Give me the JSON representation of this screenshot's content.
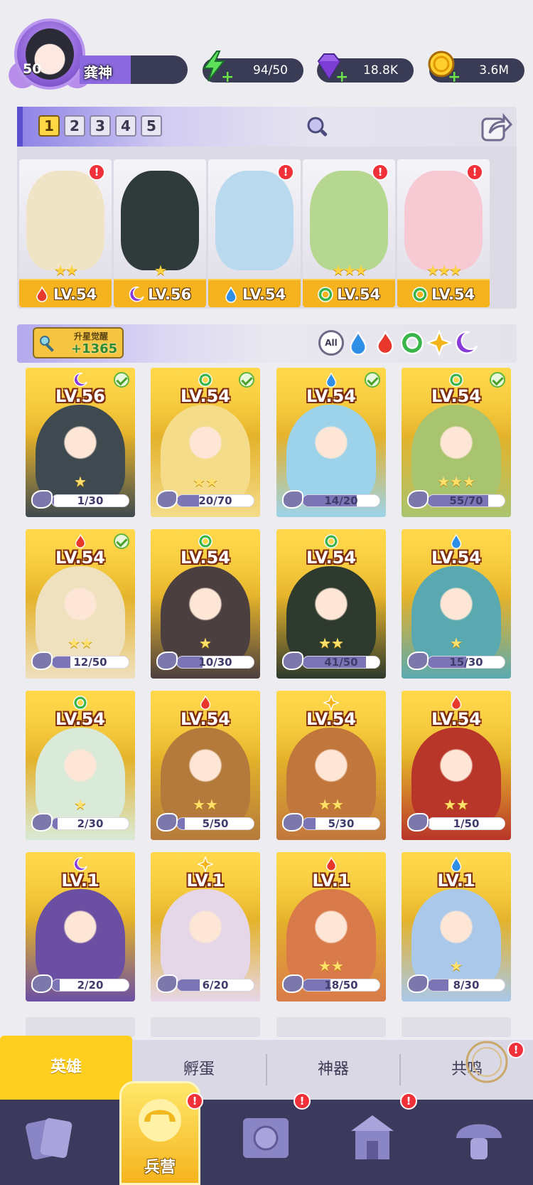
{
  "player": {
    "level": "50",
    "name": "龚神"
  },
  "resources": [
    {
      "icon": "energy-bolt-icon",
      "value": "94/50"
    },
    {
      "icon": "gem-icon",
      "value": "18.8K"
    },
    {
      "icon": "gold-coin-icon",
      "value": "3.6M"
    }
  ],
  "team_tabs": [
    "1",
    "2",
    "3",
    "4",
    "5"
  ],
  "team_active_tab": "1",
  "team": [
    {
      "level": "LV.54",
      "element": "fire",
      "stars": "★★",
      "alert": "!",
      "color": "#efe4c6"
    },
    {
      "level": "LV.56",
      "element": "dark",
      "stars": "★",
      "alert": "",
      "color": "#2f3a3a"
    },
    {
      "level": "LV.54",
      "element": "water",
      "stars": "",
      "alert": "!",
      "color": "#b9d9ee"
    },
    {
      "level": "LV.54",
      "element": "wind",
      "stars": "★★★",
      "alert": "!",
      "color": "#b6d78f"
    },
    {
      "level": "LV.54",
      "element": "wind",
      "stars": "★★★",
      "alert": "!",
      "color": "#f7c9d2"
    }
  ],
  "awaken": {
    "title": "升星觉醒",
    "value": "+1365"
  },
  "filters": [
    "All",
    "water",
    "fire",
    "wind",
    "light",
    "dark"
  ],
  "heroes": [
    {
      "level": "LV.56",
      "element": "dark",
      "shards": "1/30",
      "progress": 0.03,
      "checked": true,
      "stars": "★",
      "color": "#3f4a50"
    },
    {
      "level": "LV.54",
      "element": "wind",
      "shards": "20/70",
      "progress": 0.29,
      "checked": true,
      "stars": "★★",
      "color": "#f4dc8a"
    },
    {
      "level": "LV.54",
      "element": "water",
      "shards": "14/20",
      "progress": 0.7,
      "checked": true,
      "stars": "",
      "color": "#9cd3ea"
    },
    {
      "level": "LV.54",
      "element": "wind",
      "shards": "55/70",
      "progress": 0.79,
      "checked": true,
      "stars": "★★★",
      "color": "#a9c46f"
    },
    {
      "level": "LV.54",
      "element": "fire",
      "shards": "12/50",
      "progress": 0.24,
      "checked": true,
      "stars": "★★",
      "color": "#efe1be"
    },
    {
      "level": "LV.54",
      "element": "wind",
      "shards": "10/30",
      "progress": 0.33,
      "checked": false,
      "stars": "★",
      "color": "#4b3f3f"
    },
    {
      "level": "LV.54",
      "element": "wind",
      "shards": "41/50",
      "progress": 0.82,
      "checked": false,
      "stars": "★★",
      "color": "#2d3a2d"
    },
    {
      "level": "LV.54",
      "element": "water",
      "shards": "15/30",
      "progress": 0.5,
      "checked": false,
      "stars": "★",
      "color": "#5aa9b0"
    },
    {
      "level": "LV.54",
      "element": "wind",
      "shards": "2/30",
      "progress": 0.07,
      "checked": false,
      "stars": "★",
      "color": "#d9ead8"
    },
    {
      "level": "LV.54",
      "element": "fire",
      "shards": "5/50",
      "progress": 0.1,
      "checked": false,
      "stars": "★★",
      "color": "#b47a3c"
    },
    {
      "level": "LV.54",
      "element": "light",
      "shards": "5/30",
      "progress": 0.17,
      "checked": false,
      "stars": "★★",
      "color": "#c1773c"
    },
    {
      "level": "LV.54",
      "element": "fire",
      "shards": "1/50",
      "progress": 0.02,
      "checked": false,
      "stars": "★★",
      "color": "#b8352a"
    },
    {
      "level": "LV.1",
      "element": "dark",
      "shards": "2/20",
      "progress": 0.1,
      "checked": false,
      "stars": "",
      "color": "#6b4fa3"
    },
    {
      "level": "LV.1",
      "element": "light",
      "shards": "6/20",
      "progress": 0.3,
      "checked": false,
      "stars": "",
      "color": "#e6d7e8"
    },
    {
      "level": "LV.1",
      "element": "fire",
      "shards": "18/50",
      "progress": 0.36,
      "checked": false,
      "stars": "★★",
      "color": "#d97a4a"
    },
    {
      "level": "LV.1",
      "element": "water",
      "shards": "8/30",
      "progress": 0.27,
      "checked": false,
      "stars": "★",
      "color": "#a9c8ea"
    }
  ],
  "bottom_tabs": {
    "heroes": "英雄",
    "eggs": "孵蛋",
    "artifacts": "神器",
    "resonance": "共鸣"
  },
  "nav": {
    "barracks": "兵营"
  },
  "alert_mark": "!",
  "colors": {
    "fire": "#e8382c",
    "water": "#2f8ee6",
    "wind": "#39b54a",
    "light": "#f3b51b",
    "dark": "#8a3ad8"
  }
}
